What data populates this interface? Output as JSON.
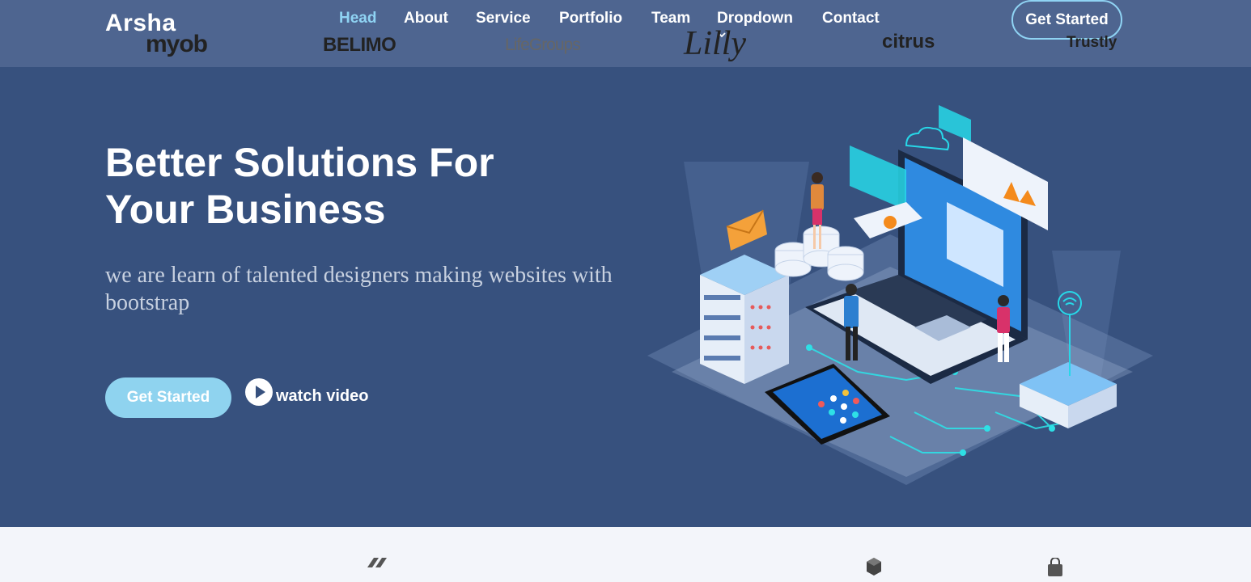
{
  "brand": {
    "logo": "Arsha"
  },
  "nav": {
    "items": [
      {
        "label": "Head",
        "active": true
      },
      {
        "label": "About"
      },
      {
        "label": "Service"
      },
      {
        "label": "Portfolio"
      },
      {
        "label": "Team"
      },
      {
        "label": "Dropdown",
        "has_dropdown": true
      },
      {
        "label": "Contact"
      }
    ],
    "cta_label": "Get Started"
  },
  "hero": {
    "title_line1": "Better Solutions For",
    "title_line2": "Your Business",
    "subtitle": "we are learn of talented designers making websites with bootstrap",
    "primary_button": "Get Started",
    "watch_label": "watch video"
  },
  "clients": [
    "myob",
    "BELIMO",
    "LifeGroups",
    "Lilly",
    "citrus",
    "Trustly"
  ],
  "colors": {
    "background": "#37517e",
    "header": "#4e6590",
    "accent": "#8fd3ef"
  },
  "icons": [
    "chevron-down-icon",
    "play-icon"
  ]
}
